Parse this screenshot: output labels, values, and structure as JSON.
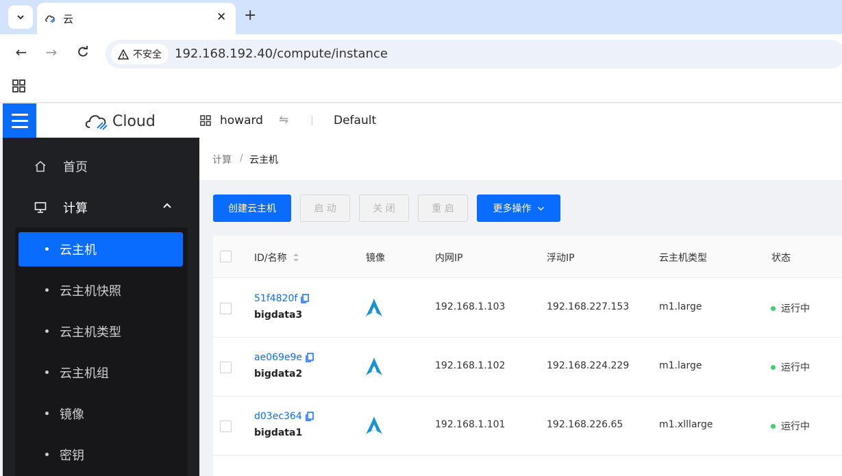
{
  "browser": {
    "tab_title": "云",
    "insecure_label": "不安全",
    "url": "192.168.192.40/compute/instance"
  },
  "header": {
    "logo_text": "Cloud",
    "project": "howard",
    "domain": "Default"
  },
  "sidebar": {
    "items": [
      {
        "label": "首页",
        "icon": "home-icon"
      },
      {
        "label": "计算",
        "icon": "monitor-icon",
        "expanded": true
      }
    ],
    "compute_sub": [
      {
        "label": "云主机",
        "active": true
      },
      {
        "label": "云主机快照"
      },
      {
        "label": "云主机类型"
      },
      {
        "label": "云主机组"
      },
      {
        "label": "镜像"
      },
      {
        "label": "密钥"
      }
    ]
  },
  "breadcrumb": {
    "parent": "计算",
    "separator": "/",
    "current": "云主机"
  },
  "actions": {
    "create": "创建云主机",
    "start": "启 动",
    "stop": "关 闭",
    "restart": "重 启",
    "more": "更多操作"
  },
  "table": {
    "columns": [
      "ID/名称",
      "镜像",
      "内网IP",
      "浮动IP",
      "云主机类型",
      "状态"
    ],
    "rows": [
      {
        "id": "51f4820f",
        "name": "bigdata3",
        "image_icon": "arch-linux-icon",
        "private_ip": "192.168.1.103",
        "floating_ip": "192.168.227.153",
        "flavor": "m1.large",
        "status": "运行中"
      },
      {
        "id": "ae069e9e",
        "name": "bigdata2",
        "image_icon": "arch-linux-icon",
        "private_ip": "192.168.1.102",
        "floating_ip": "192.168.224.229",
        "flavor": "m1.large",
        "status": "运行中"
      },
      {
        "id": "d03ec364",
        "name": "bigdata1",
        "image_icon": "arch-linux-icon",
        "private_ip": "192.168.1.101",
        "floating_ip": "192.168.226.65",
        "flavor": "m1.xlllarge",
        "status": "运行中"
      }
    ]
  },
  "colors": {
    "primary": "#0a6cff",
    "sidebar_bg": "#1f2023",
    "status_running": "#3ecf6e"
  }
}
